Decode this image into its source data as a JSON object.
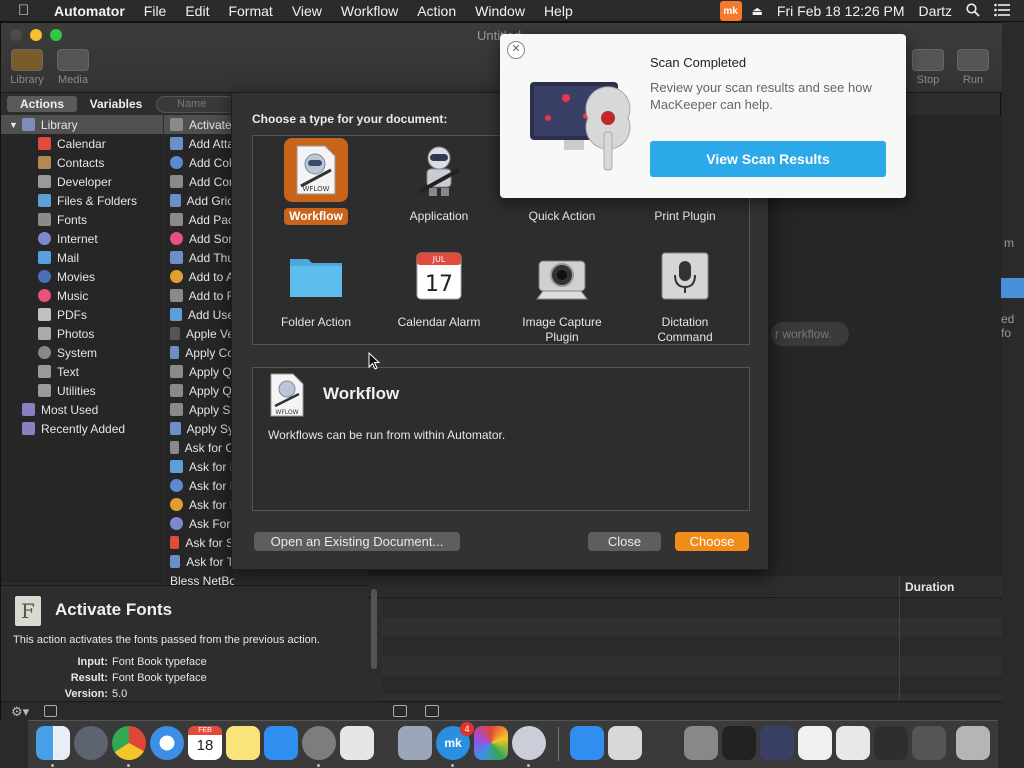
{
  "menubar": {
    "app_name": "Automator",
    "items": [
      "File",
      "Edit",
      "Format",
      "View",
      "Workflow",
      "Action",
      "Window",
      "Help"
    ],
    "mk_status_label": "mk",
    "clock": "Fri Feb 18  12:26 PM",
    "user": "Dartz"
  },
  "window": {
    "title": "Untitled",
    "toolbar": {
      "library": "Library",
      "media": "Media",
      "stop": "Stop",
      "run": "Run"
    },
    "tabs": {
      "actions": "Actions",
      "variables": "Variables"
    },
    "search_placeholder": "Name"
  },
  "library": {
    "root": "Library",
    "items": [
      "Calendar",
      "Contacts",
      "Developer",
      "Files & Folders",
      "Fonts",
      "Internet",
      "Mail",
      "Movies",
      "Music",
      "PDFs",
      "Photos",
      "System",
      "Text",
      "Utilities"
    ],
    "most_used": "Most Used",
    "recently_added": "Recently Added"
  },
  "actions_list": [
    "Activate",
    "Add Atta",
    "Add Col",
    "Add Cor",
    "Add Grid",
    "Add Pac",
    "Add Sor",
    "Add Thu",
    "Add to A",
    "Add to F",
    "Add Use",
    "Apple Ve",
    "Apply Co",
    "Apply Q",
    "Apply Q",
    "Apply St",
    "Apply Sy",
    "Ask for C",
    "Ask for I",
    "Ask for I",
    "Ask for I",
    "Ask For",
    "Ask for S",
    "Ask for T",
    "Bless NetBoot Image Folder"
  ],
  "description": {
    "icon_letter": "F",
    "title": "Activate Fonts",
    "text": "This action activates the fonts passed from the previous action.",
    "input_label": "Input:",
    "input_value": "Font Book typeface",
    "result_label": "Result:",
    "result_value": "Font Book typeface",
    "version_label": "Version:",
    "version_value": "5.0"
  },
  "workflow": {
    "hint": "r workflow.",
    "duration_header": "Duration",
    "side_text": "ed fo",
    "side_text2": "m"
  },
  "sheet": {
    "prompt": "Choose a type for your document:",
    "types": [
      {
        "label": "Workflow",
        "selected": true,
        "icon": "workflow-icon"
      },
      {
        "label": "Application",
        "selected": false,
        "icon": "application-icon"
      },
      {
        "label": "Quick Action",
        "selected": false,
        "icon": "quick-action-icon"
      },
      {
        "label": "Print Plugin",
        "selected": false,
        "icon": "print-plugin-icon"
      },
      {
        "label": "Folder Action",
        "selected": false,
        "icon": "folder-icon"
      },
      {
        "label": "Calendar Alarm",
        "selected": false,
        "icon": "calendar-icon"
      },
      {
        "label": "Image Capture Plugin",
        "selected": false,
        "icon": "camera-icon"
      },
      {
        "label": "Dictation Command",
        "selected": false,
        "icon": "microphone-icon"
      }
    ],
    "calendar_month": "JUL",
    "calendar_day": "17",
    "wflow_badge": "WFLOW",
    "info_title": "Workflow",
    "info_text": "Workflows can be run from within Automator.",
    "open_button": "Open an Existing Document...",
    "close_button": "Close",
    "choose_button": "Choose"
  },
  "notification": {
    "title": "Scan Completed",
    "text": "Review your scan results and see how MacKeeper can help.",
    "button": "View Scan Results"
  },
  "dock": {
    "calendar_month": "FEB",
    "calendar_day": "18",
    "mackeeper_badge": "4",
    "mackeeper_label": "mk"
  },
  "colors": {
    "accent_orange": "#f18b1a",
    "selection_orange": "#c8651b",
    "notification_button": "#2ba9e8"
  }
}
